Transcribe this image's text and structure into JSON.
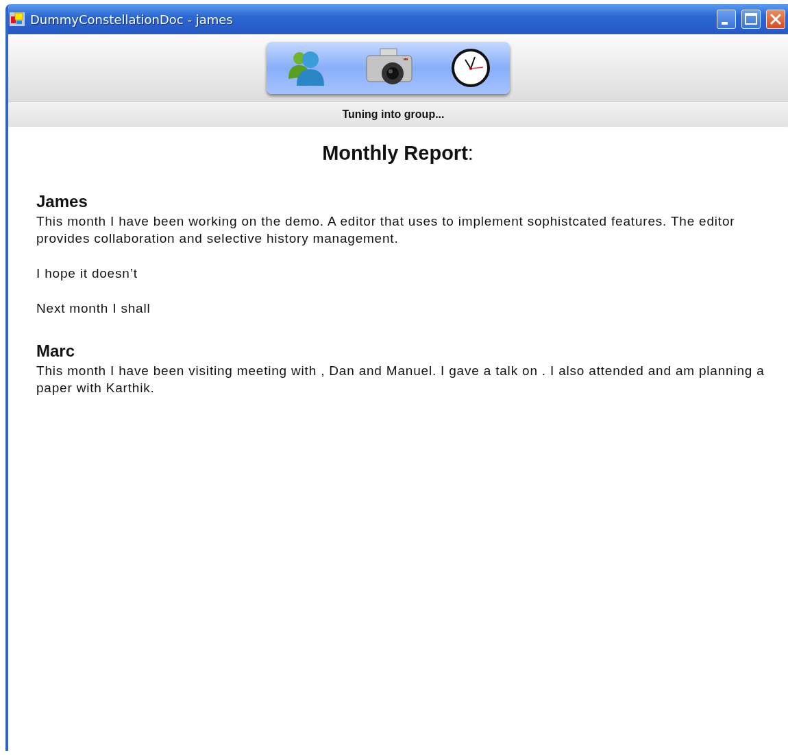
{
  "window": {
    "title": "DummyConstellationDoc - james"
  },
  "status": "Tuning into group...",
  "report": {
    "title": "**Monthly Report**:",
    "sections": [
      {
        "name": "James",
        "paragraphs": [
          "This month I have been working on the demo. A editor that uses to implement sophistcated features. The editor provides collaboration and selective history management.",
          "I hope it doesn’t",
          "Next month I shall"
        ]
      },
      {
        "name": "Marc",
        "paragraphs": [
          "This month I have been visiting meeting with , Dan and Manuel. I gave a talk on . I also attended and am planning a paper with Karthik."
        ]
      }
    ]
  }
}
